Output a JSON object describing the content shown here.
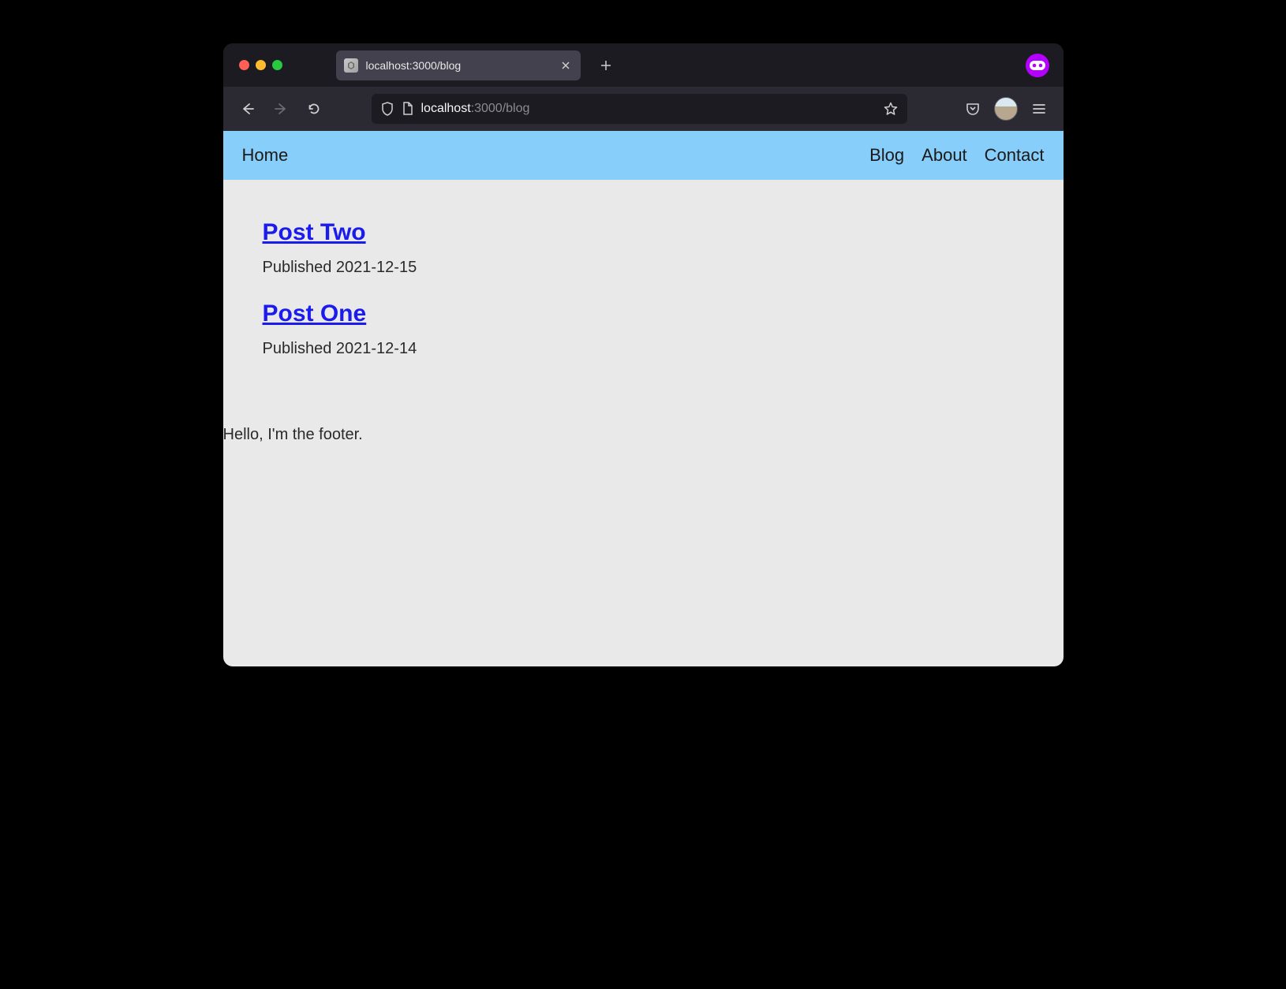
{
  "browser": {
    "tab_title": "localhost:3000/blog",
    "url_host": "localhost",
    "url_path": ":3000/blog"
  },
  "header": {
    "home": "Home",
    "nav": [
      {
        "label": "Blog"
      },
      {
        "label": "About"
      },
      {
        "label": "Contact"
      }
    ]
  },
  "posts": [
    {
      "title": "Post Two",
      "published_prefix": "Published ",
      "date": "2021-12-15"
    },
    {
      "title": "Post One",
      "published_prefix": "Published ",
      "date": "2021-12-14"
    }
  ],
  "footer": {
    "text": "Hello, I'm the footer."
  }
}
